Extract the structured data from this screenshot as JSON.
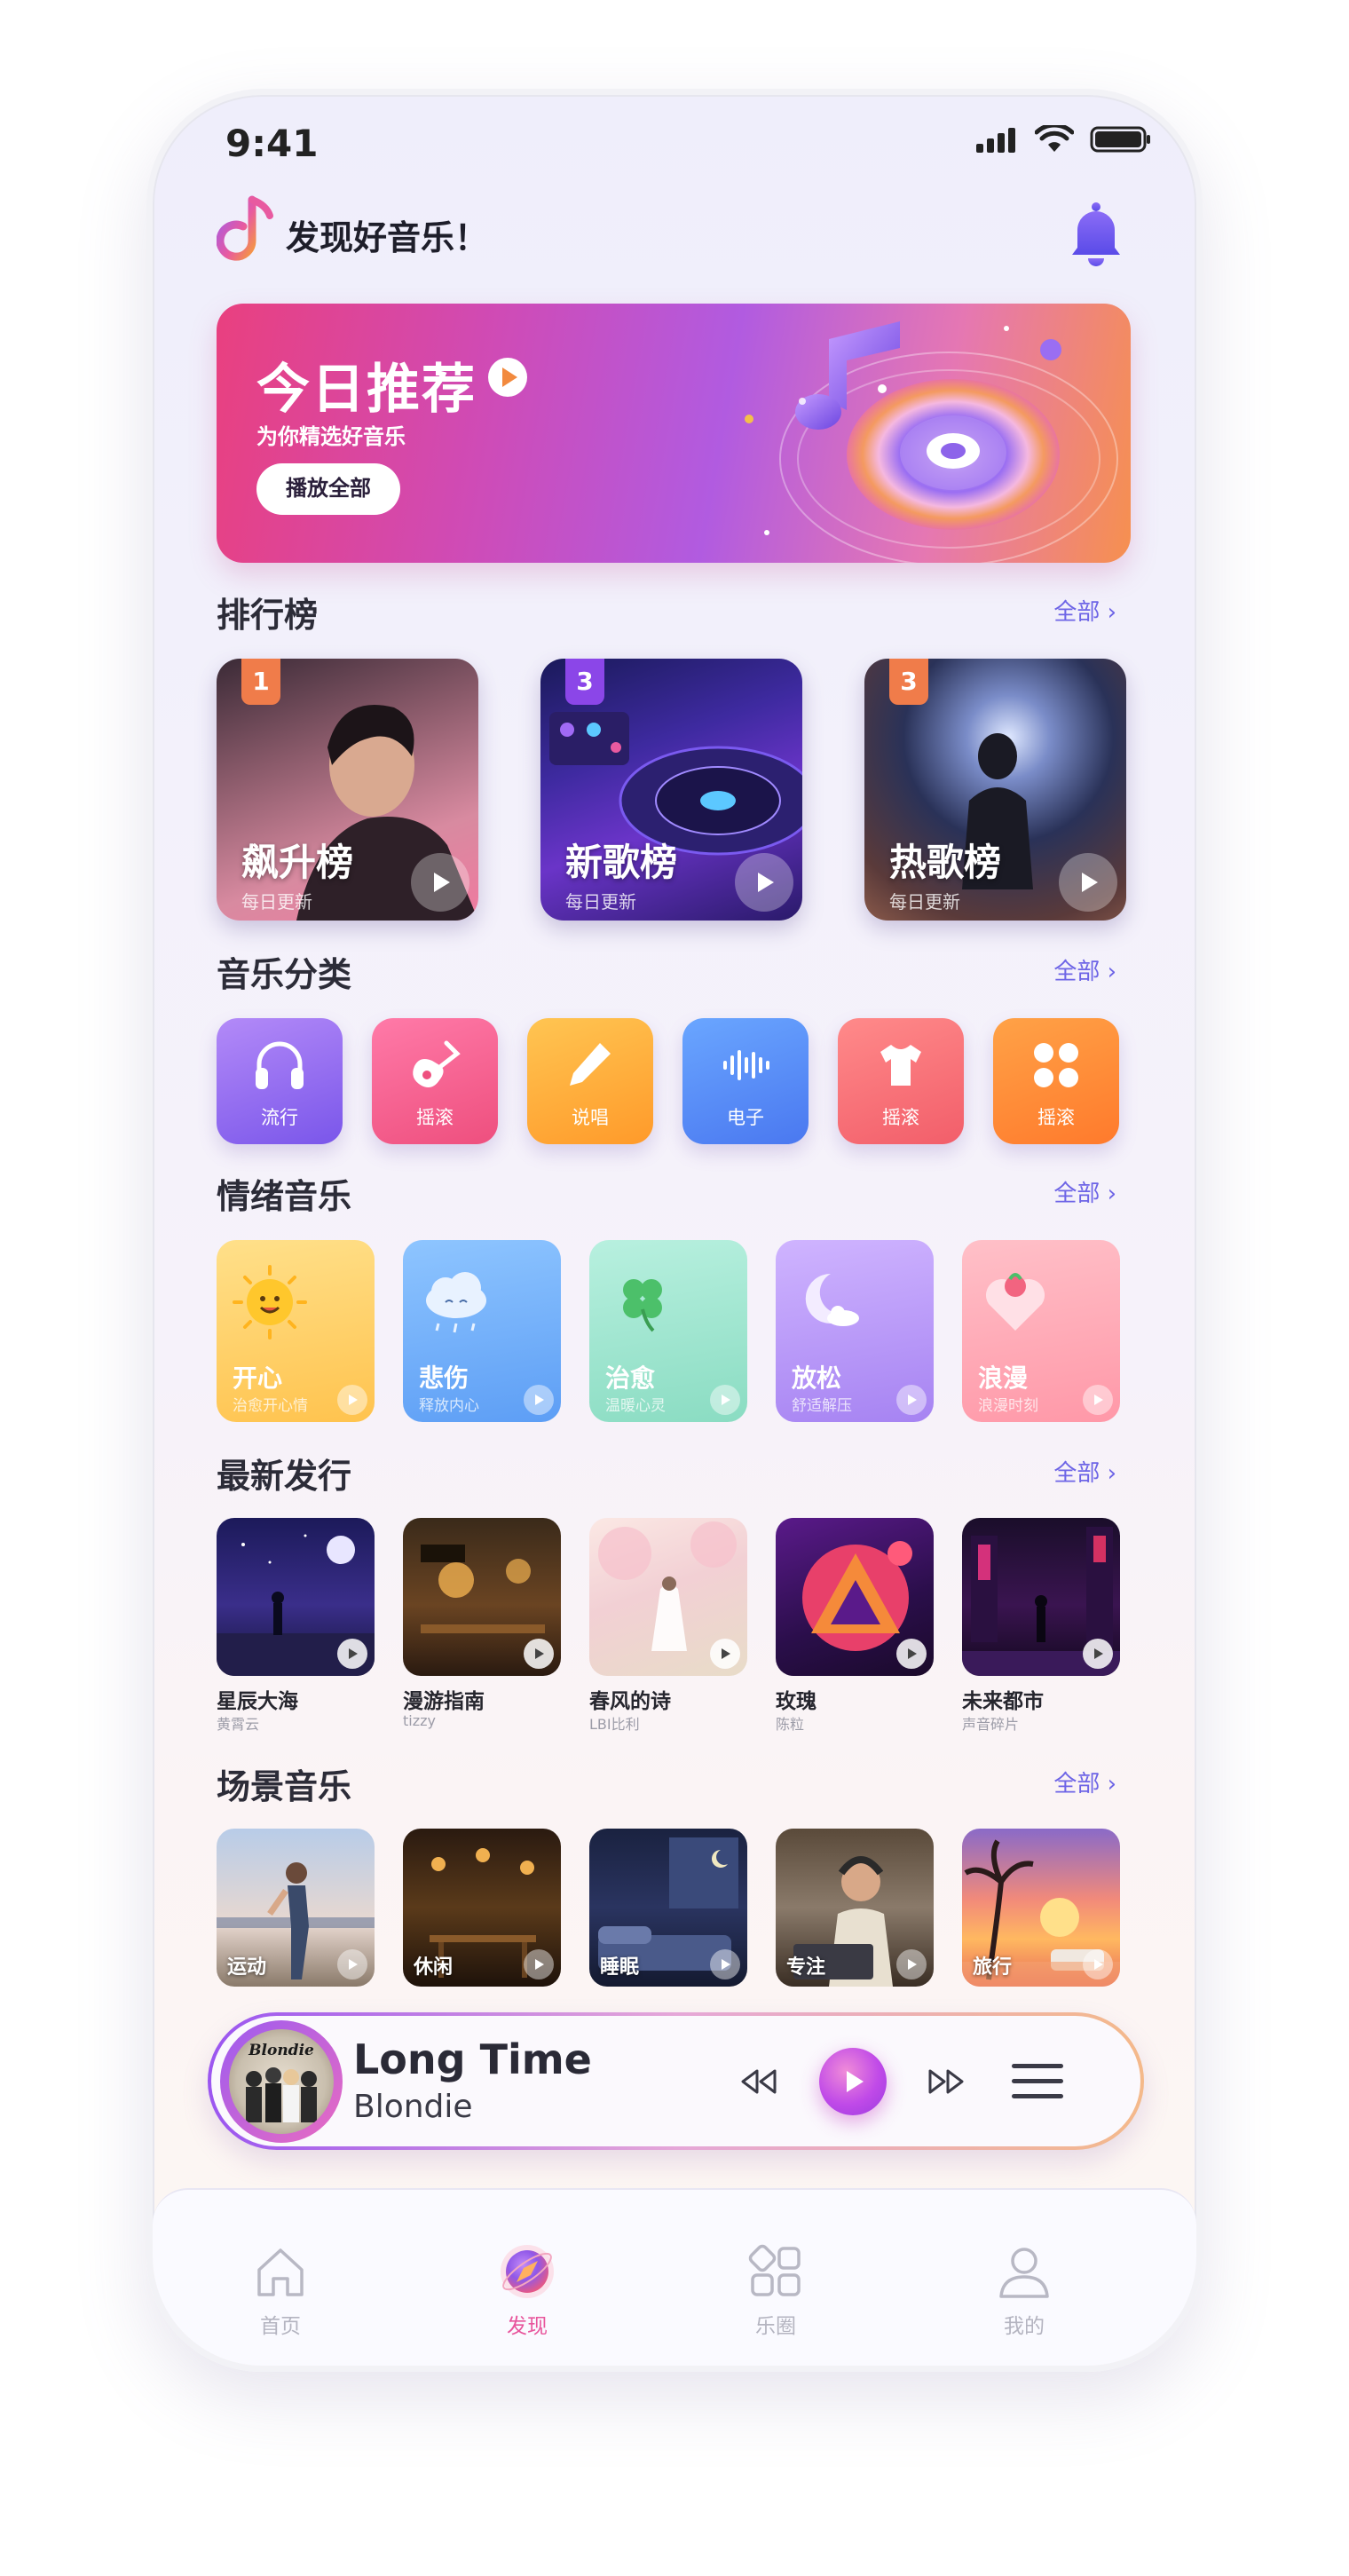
{
  "status_bar": {
    "time": "9:41"
  },
  "header": {
    "title": "发现好音乐！"
  },
  "banner": {
    "title": "今日推荐",
    "subtitle": "为你精选好音乐",
    "button": "播放全部"
  },
  "rankings": {
    "title": "排行榜",
    "more": "全部",
    "items": [
      {
        "rank": "1",
        "name": "飙升榜",
        "sub": "每日更新"
      },
      {
        "rank": "3",
        "name": "新歌榜",
        "sub": "每日更新"
      },
      {
        "rank": "3",
        "name": "热歌榜",
        "sub": "每日更新"
      }
    ]
  },
  "genres": {
    "title": "音乐分类",
    "more": "全部",
    "items": [
      {
        "label": "流行",
        "icon": "headphones-icon"
      },
      {
        "label": "摇滚",
        "icon": "guitar-icon"
      },
      {
        "label": "说唱",
        "icon": "pencil-icon"
      },
      {
        "label": "电子",
        "icon": "waveform-icon"
      },
      {
        "label": "摇滚",
        "icon": "tshirt-icon"
      },
      {
        "label": "摇滚",
        "icon": "clover-icon"
      }
    ]
  },
  "moods": {
    "title": "情绪音乐",
    "more": "全部",
    "items": [
      {
        "name": "开心",
        "sub": "治愈开心情"
      },
      {
        "name": "悲伤",
        "sub": "释放内心"
      },
      {
        "name": "治愈",
        "sub": "温暖心灵"
      },
      {
        "name": "放松",
        "sub": "舒适解压"
      },
      {
        "name": "浪漫",
        "sub": "浪漫时刻"
      }
    ]
  },
  "releases": {
    "title": "最新发行",
    "more": "全部",
    "items": [
      {
        "title": "星辰大海",
        "artist": "黄霄云"
      },
      {
        "title": "漫游指南",
        "artist": "tizzy"
      },
      {
        "title": "春风的诗",
        "artist": "LBI比利"
      },
      {
        "title": "玫瑰",
        "artist": "陈粒"
      },
      {
        "title": "未来都市",
        "artist": "声音碎片"
      }
    ]
  },
  "scenes": {
    "title": "场景音乐",
    "more": "全部",
    "items": [
      {
        "label": "运动"
      },
      {
        "label": "休闲"
      },
      {
        "label": "睡眠"
      },
      {
        "label": "专注"
      },
      {
        "label": "旅行"
      }
    ]
  },
  "player": {
    "title": "Long Time",
    "artist": "Blondie",
    "cover_text": "Blondie"
  },
  "tabbar": {
    "items": [
      {
        "label": "首页",
        "icon": "home-icon"
      },
      {
        "label": "发现",
        "icon": "compass-icon"
      },
      {
        "label": "乐圈",
        "icon": "grid-icon"
      },
      {
        "label": "我的",
        "icon": "user-icon"
      }
    ],
    "active_color": "#e8559c"
  }
}
